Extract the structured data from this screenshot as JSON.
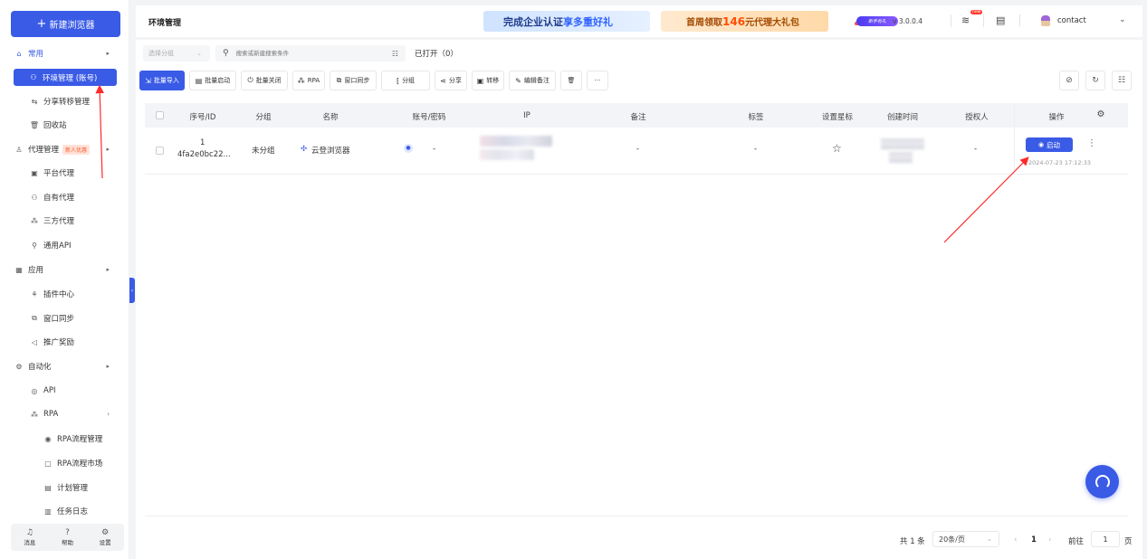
{
  "sidebar": {
    "new_browser": "新建浏览器",
    "items": [
      {
        "label": "常用",
        "type": "group",
        "icon": "home-icon",
        "glyph": "⌂"
      },
      {
        "label": "环境管理 (账号)",
        "type": "active",
        "icon": "user-env-icon",
        "glyph": "⚇"
      },
      {
        "label": "分享转移管理",
        "type": "sub",
        "icon": "transfer-icon",
        "glyph": "⇆"
      },
      {
        "label": "回收站",
        "type": "sub",
        "icon": "trash-icon",
        "glyph": "🗑"
      },
      {
        "label": "代理管理",
        "badge": "新人优惠",
        "type": "top",
        "icon": "proxy-icon",
        "glyph": "♙"
      },
      {
        "label": "平台代理",
        "type": "sub",
        "icon": "platform-proxy-icon",
        "glyph": "▣"
      },
      {
        "label": "自有代理",
        "type": "sub",
        "icon": "own-proxy-icon",
        "glyph": "⚇"
      },
      {
        "label": "三方代理",
        "type": "sub",
        "icon": "third-party-proxy-icon",
        "glyph": "⁂"
      },
      {
        "label": "通用API",
        "type": "sub",
        "icon": "api-key-icon",
        "glyph": "⚲"
      },
      {
        "label": "应用",
        "type": "top",
        "icon": "apps-grid-icon",
        "glyph": "▦"
      },
      {
        "label": "插件中心",
        "type": "sub",
        "icon": "plugin-icon",
        "glyph": "⚘"
      },
      {
        "label": "窗口同步",
        "type": "sub",
        "icon": "window-sync-icon",
        "glyph": "⧉"
      },
      {
        "label": "推广奖励",
        "type": "sub",
        "icon": "megaphone-icon",
        "glyph": "◁"
      },
      {
        "label": "自动化",
        "type": "top",
        "icon": "robot-icon",
        "glyph": "⚙"
      },
      {
        "label": "API",
        "type": "sub",
        "icon": "api-icon",
        "glyph": "◎"
      },
      {
        "label": "RPA",
        "type": "sub",
        "icon": "rpa-icon",
        "glyph": "⁂"
      },
      {
        "label": "RPA流程管理",
        "type": "sub3",
        "icon": "rpa-flow-icon",
        "glyph": "◉"
      },
      {
        "label": "RPA流程市场",
        "type": "sub3",
        "icon": "rpa-market-icon",
        "glyph": "▢"
      },
      {
        "label": "计划管理",
        "type": "sub3",
        "icon": "plan-icon",
        "glyph": "▤"
      },
      {
        "label": "任务日志",
        "type": "sub3",
        "icon": "log-icon",
        "glyph": "▥"
      }
    ],
    "bottom": [
      {
        "label": "消息",
        "icon": "bell-icon",
        "glyph": "♫"
      },
      {
        "label": "帮助",
        "icon": "help-icon",
        "glyph": "?"
      },
      {
        "label": "设置",
        "icon": "settings-icon",
        "glyph": "⚙"
      }
    ]
  },
  "header": {
    "title": "环境管理",
    "banner1_pre": "完成企业认证",
    "banner1_hl": "享多重好礼",
    "banner2_pre": "首周领取",
    "banner2_hl": "146",
    "banner2_post": "元代理大礼包",
    "promo": "新手有礼",
    "version": "v 3.0.0.4",
    "new_tag": "new",
    "user": "contact"
  },
  "filters": {
    "group_placeholder": "选择分组",
    "search_placeholder": "搜索或新建搜索条件",
    "opened": "已打开（0）"
  },
  "toolbar": {
    "batch_import": "批量导入",
    "batch_start": "批量启动",
    "batch_close": "批量关闭",
    "rpa": "RPA",
    "window_sync": "窗口同步",
    "group": "分组",
    "share": "分享",
    "transfer": "转移",
    "edit_note": "编辑备注",
    "more": "···"
  },
  "table": {
    "headers": [
      "序号/ID",
      "分组",
      "名称",
      "账号/密码",
      "IP",
      "备注",
      "标签",
      "设置星标",
      "创建时间",
      "授权人",
      "操作"
    ],
    "rows": [
      {
        "index": "1",
        "id": "4fa2e0bc22...",
        "group": "未分组",
        "name": "云登浏览器",
        "account": "-",
        "note": "-",
        "tag": "-",
        "authorizer": "-",
        "start": "启动",
        "created_at": "2024-07-23 17:12:33"
      }
    ]
  },
  "pagination": {
    "total": "共 1 条",
    "page_size": "20条/页",
    "prev": "‹",
    "current": "1",
    "next": "›",
    "goto_label": "前往",
    "goto_value": "1",
    "unit": "页"
  }
}
